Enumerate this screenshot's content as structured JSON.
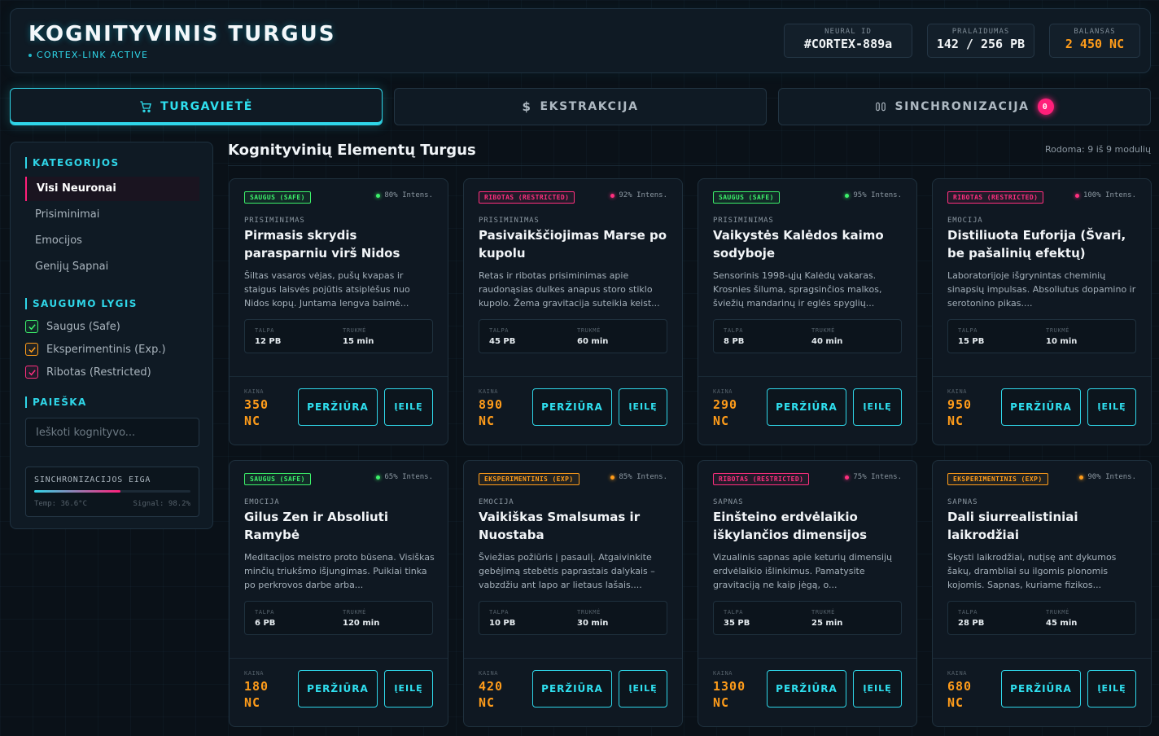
{
  "header": {
    "title": "KOGNITYVINIS TURGUS",
    "status": "CORTEX-LINK ACTIVE",
    "stats": [
      {
        "label": "NEURAL ID",
        "value": "#CORTEX-889a"
      },
      {
        "label": "PRALAIDUMAS",
        "value": "142 / 256 PB"
      },
      {
        "label": "BALANSAS",
        "value": "2 450 NC"
      }
    ]
  },
  "tabs": [
    {
      "label": "TURGAVIETĖ",
      "icon": "cart-icon"
    },
    {
      "label": "EKSTRAKCIJA",
      "icon": "dollar-icon"
    },
    {
      "label": "SINCHRONIZACIJA",
      "icon": "sync-icon",
      "badge": "0"
    }
  ],
  "sidebar": {
    "categories_title": "KATEGORIJOS",
    "categories": [
      "Visi Neuronai",
      "Prisiminimai",
      "Emocijos",
      "Genijų Sapnai"
    ],
    "safety_title": "SAUGUMO LYGIS",
    "safety": [
      "Saugus (Safe)",
      "Eksperimentinis (Exp.)",
      "Ribotas (Restricted)"
    ],
    "search_title": "PAIEŠKA",
    "search_placeholder": "Ieškoti kognityvo...",
    "sync": {
      "title": "SINCHRONIZACIJOS EIGA",
      "progress": 0.55,
      "temp": "Temp: 36.6°C",
      "signal": "Signal: 98.2%"
    }
  },
  "main": {
    "title": "Kognityvinių Elementų Turgus",
    "showing": "Rodoma: 9 iš 9 modulių",
    "labels": {
      "capacity": "TALPA",
      "duration": "TRUKMĖ",
      "price": "KAINA",
      "view": "PERŽIŪRA",
      "queue_line1": "Į",
      "queue_line2": "EILĘ"
    },
    "cards": [
      {
        "tag": "SAUGUS (SAFE)",
        "level": "safe",
        "intensity": "80% Intens.",
        "type": "PRISIMINIMAS",
        "name": "Pirmasis skrydis parasparniu virš Nidos",
        "desc": "Šiltas vasaros vėjas, pušų kvapas ir staigus laisvės pojūtis atsiplėšus nuo Nidos kopų. Juntama lengva baimė...",
        "capacity": "12 PB",
        "duration": "15 min",
        "price": "350 NC"
      },
      {
        "tag": "RIBOTAS (RESTRICTED)",
        "level": "restr",
        "intensity": "92% Intens.",
        "type": "PRISIMINIMAS",
        "name": "Pasivaikščiojimas Marse po kupolu",
        "desc": "Retas ir ribotas prisiminimas apie raudonąsias dulkes anapus storo stiklo kupolo. Žema gravitacija suteikia keist...",
        "capacity": "45 PB",
        "duration": "60 min",
        "price": "890 NC"
      },
      {
        "tag": "SAUGUS (SAFE)",
        "level": "safe",
        "intensity": "95% Intens.",
        "type": "PRISIMINIMAS",
        "name": "Vaikystės Kalėdos kaimo sodyboje",
        "desc": "Sensorinis 1998-ųjų Kalėdų vakaras. Krosnies šiluma, spragsinčios malkos, šviežių mandarinų ir eglės spyglių...",
        "capacity": "8 PB",
        "duration": "40 min",
        "price": "290 NC"
      },
      {
        "tag": "RIBOTAS (RESTRICTED)",
        "level": "restr",
        "intensity": "100% Intens.",
        "type": "EMOCIJA",
        "name": "Distiliuota Euforija (Švari, be pašalinių efektų)",
        "desc": "Laboratorijoje išgrynintas cheminių sinapsių impulsas. Absoliutus dopamino ir serotonino pikas....",
        "capacity": "15 PB",
        "duration": "10 min",
        "price": "950 NC"
      },
      {
        "tag": "SAUGUS (SAFE)",
        "level": "safe",
        "intensity": "65% Intens.",
        "type": "EMOCIJA",
        "name": "Gilus Zen ir Absoliuti Ramybė",
        "desc": "Meditacijos meistro proto būsena. Visiškas minčių triukšmo išjungimas. Puikiai tinka po perkrovos darbe arba...",
        "capacity": "6 PB",
        "duration": "120 min",
        "price": "180 NC"
      },
      {
        "tag": "EKSPERIMENTINIS (EXP)",
        "level": "exp",
        "intensity": "85% Intens.",
        "type": "EMOCIJA",
        "name": "Vaikiškas Smalsumas ir Nuostaba",
        "desc": "Šviežias požiūris į pasaulį. Atgaivinkite gebėjimą stebėtis paprastais dalykais – vabzdžiu ant lapo ar lietaus lašais....",
        "capacity": "10 PB",
        "duration": "30 min",
        "price": "420 NC"
      },
      {
        "tag": "RIBOTAS (RESTRICTED)",
        "level": "restr",
        "intensity": "75% Intens.",
        "type": "SAPNAS",
        "name": "Einšteino erdvėlaikio iškylančios dimensijos",
        "desc": "Vizualinis sapnas apie keturių dimensijų erdvėlaikio išlinkimus. Pamatysite gravitaciją ne kaip jėgą, o...",
        "capacity": "35 PB",
        "duration": "25 min",
        "price": "1300 NC"
      },
      {
        "tag": "EKSPERIMENTINIS (EXP)",
        "level": "exp",
        "intensity": "90% Intens.",
        "type": "SAPNAS",
        "name": "Dali siurrealistiniai laikrodžiai",
        "desc": "Skysti laikrodžiai, nutįsę ant dykumos šakų, drambliai su ilgomis plonomis kojomis. Sapnas, kuriame fizikos...",
        "capacity": "28 PB",
        "duration": "45 min",
        "price": "680 NC"
      }
    ]
  },
  "colors": {
    "accent": "#2fd6e8",
    "safe": "#3cf06a",
    "restricted": "#ff2f7e",
    "experimental": "#ff9c1a"
  }
}
